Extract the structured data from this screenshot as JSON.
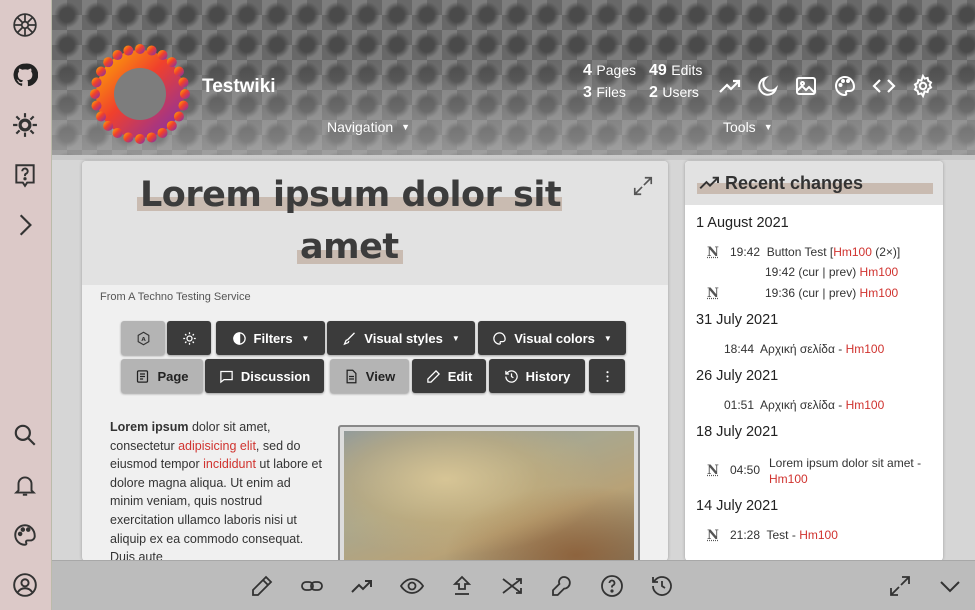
{
  "site": {
    "title": "Testwiki"
  },
  "stats": {
    "pages_count": "4",
    "pages_label": "Pages",
    "edits_count": "49",
    "edits_label": "Edits",
    "files_count": "3",
    "files_label": "Files",
    "users_count": "2",
    "users_label": "Users"
  },
  "menus": {
    "navigation": "Navigation",
    "tools": "Tools"
  },
  "article": {
    "title_line1": "Lorem ipsum dolor sit",
    "title_line2": "amet",
    "subtitle": "From A Techno Testing Service",
    "text": {
      "bold": "Lorem ipsum",
      "t1": " dolor sit amet, consectetur ",
      "link1": "adipisicing elit",
      "t2": ", sed do eiusmod tempor ",
      "link2": "incididunt",
      "t3": " ut labore et dolore magna aliqua. Ut enim ad minim veniam, quis nostrud exercitation ullamco laboris nisi ut aliquip ex ea commodo consequat. Duis aute"
    }
  },
  "toolbar": {
    "filters": "Filters",
    "visual_styles": "Visual styles",
    "visual_colors": "Visual colors",
    "page": "Page",
    "discussion": "Discussion",
    "view": "View",
    "edit": "Edit",
    "history": "History"
  },
  "recent_changes": {
    "title": "Recent changes",
    "groups": [
      {
        "date": "1 August 2021"
      },
      {
        "date": "31 July 2021"
      },
      {
        "date": "26 July 2021"
      },
      {
        "date": "18 July 2021"
      },
      {
        "date": "14 July 2021"
      }
    ],
    "entries": {
      "e1_time": "19:42",
      "e1_title": "Button Test",
      "e1_user": "Hm100",
      "e1_extra": "(2×)",
      "e2_time": "19:42",
      "e2_cur": "(cur",
      "e2_prev": "prev)",
      "e2_user": "Hm100",
      "e3_time": "19:36",
      "e3_cur": "(cur",
      "e3_prev": "prev)",
      "e3_user": "Hm100",
      "e4_time": "18:44",
      "e4_title": "Αρχική σελίδα",
      "e4_user": "Hm100",
      "e5_time": "01:51",
      "e5_title": "Αρχική σελίδα",
      "e5_user": "Hm100",
      "e6_time": "04:50",
      "e6_title": "Lorem ipsum dolor sit amet",
      "e6_user": "Hm100",
      "e7_time": "21:28",
      "e7_title": "Test",
      "e7_user": "Hm100",
      "new_mark": "N",
      "sep": "-",
      "pipe": "|"
    }
  },
  "colors": {
    "accent": "#d0332f",
    "highlight": "#c9bbb1",
    "dark_button": "#3b3b3b",
    "rail": "#dcc9c8"
  }
}
